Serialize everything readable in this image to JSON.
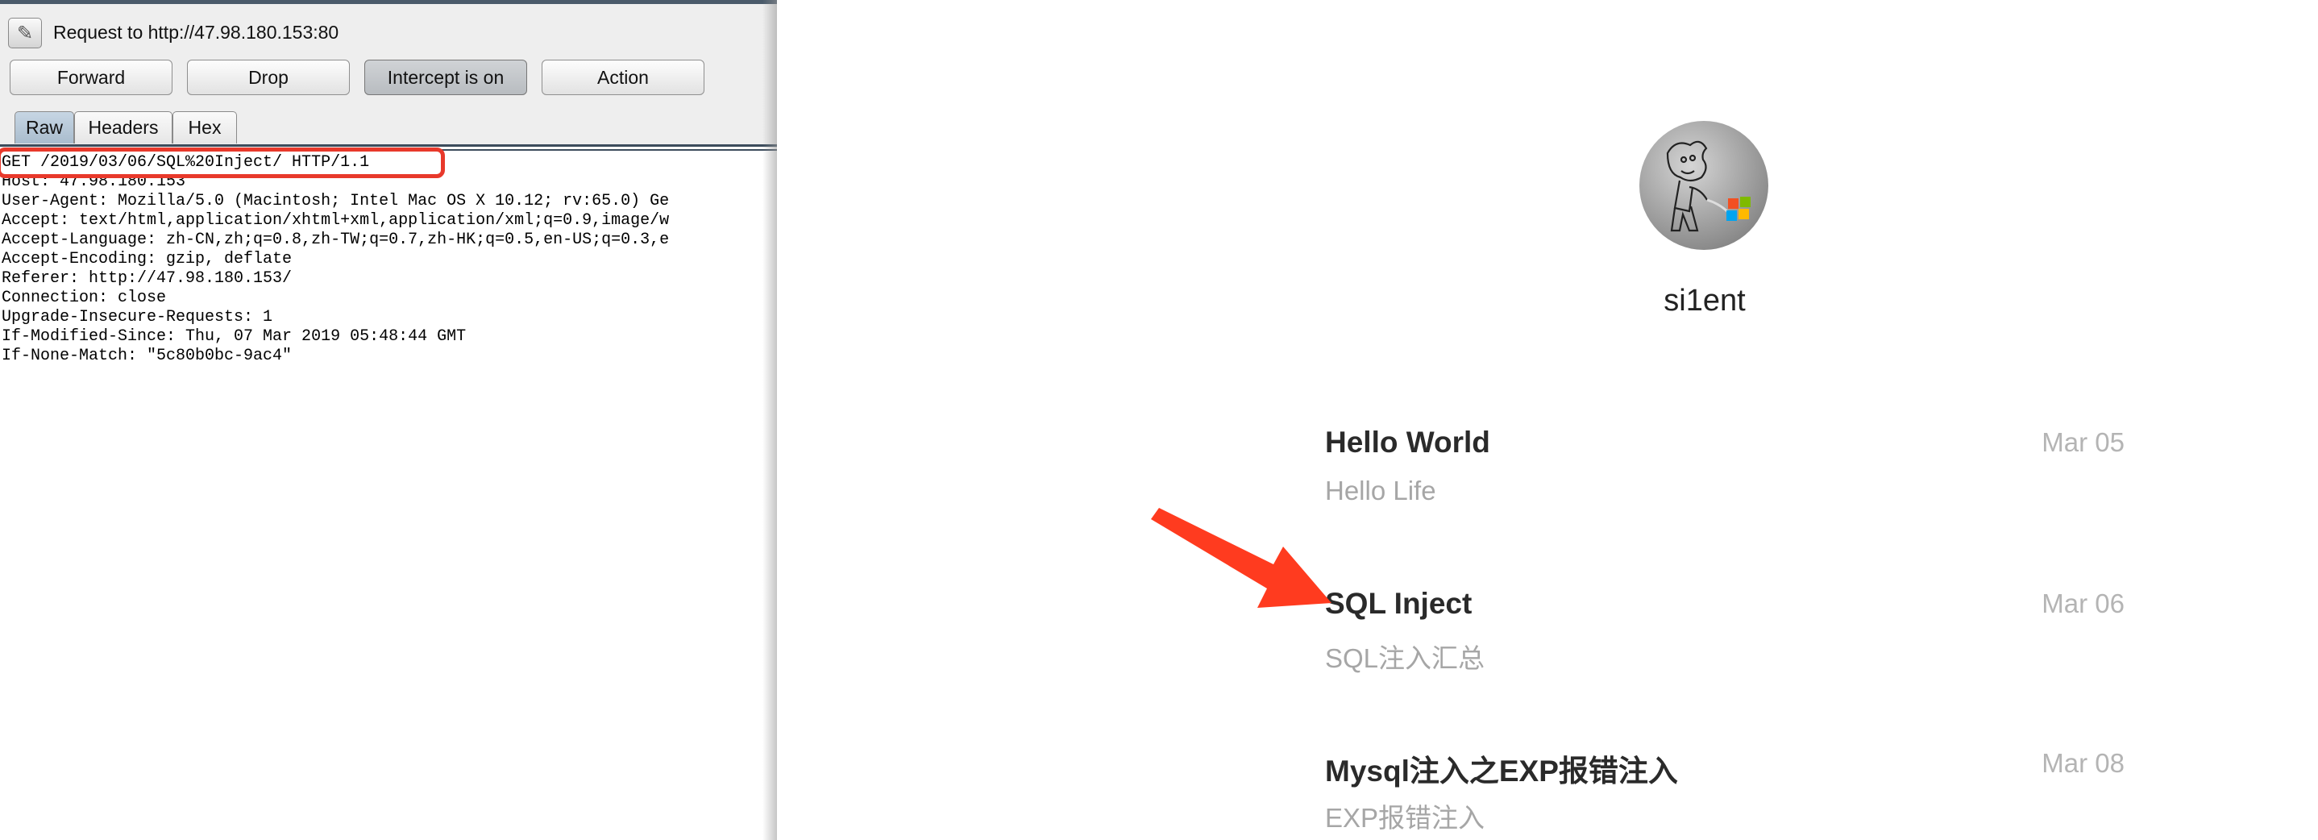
{
  "proxy": {
    "request_title": "Request to http://47.98.180.153:80",
    "buttons": {
      "forward": "Forward",
      "drop": "Drop",
      "intercept": "Intercept is on",
      "action": "Action"
    },
    "tabs": {
      "raw": "Raw",
      "headers": "Headers",
      "hex": "Hex"
    },
    "request_lines": [
      "GET /2019/03/06/SQL%20Inject/ HTTP/1.1",
      "Host: 47.98.180.153",
      "User-Agent: Mozilla/5.0 (Macintosh; Intel Mac OS X 10.12; rv:65.0) Ge",
      "Accept: text/html,application/xhtml+xml,application/xml;q=0.9,image/w",
      "Accept-Language: zh-CN,zh;q=0.8,zh-TW;q=0.7,zh-HK;q=0.5,en-US;q=0.3,e",
      "Accept-Encoding: gzip, deflate",
      "Referer: http://47.98.180.153/",
      "Connection: close",
      "Upgrade-Insecure-Requests: 1",
      "If-Modified-Since: Thu, 07 Mar 2019 05:48:44 GMT",
      "If-None-Match: \"5c80b0bc-9ac4\""
    ],
    "icons": {
      "request": "pencil-icon"
    }
  },
  "blog": {
    "author": "si1ent",
    "posts": [
      {
        "title": "Hello World",
        "subtitle": "Hello Life",
        "date": "Mar 05"
      },
      {
        "title": "SQL Inject",
        "subtitle": "SQL注入汇总",
        "date": "Mar 06"
      },
      {
        "title": "Mysql注入之EXP报错注入",
        "subtitle": "EXP报错注入",
        "date": "Mar 08"
      }
    ]
  },
  "colors": {
    "highlight": "#e8392b",
    "active_tab": "#a9bccd",
    "date_gray": "#b4b4b4"
  }
}
